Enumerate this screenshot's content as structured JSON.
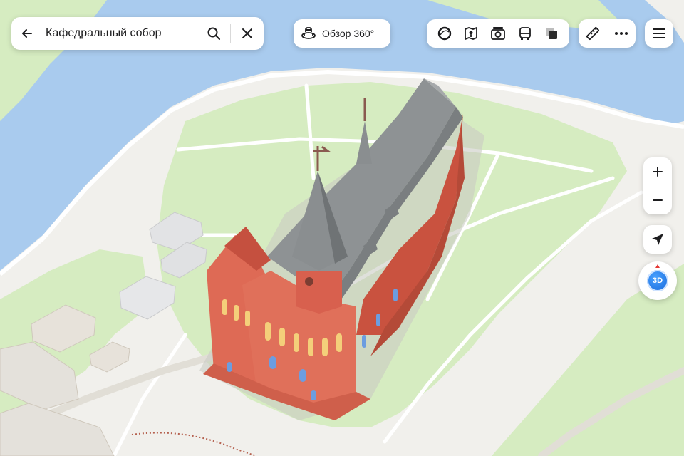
{
  "search": {
    "query": "Кафедральный собор"
  },
  "toolbar": {
    "panorama_label": "Обзор 360°"
  },
  "layers": [
    {
      "icon": "traffic-circle-icon"
    },
    {
      "icon": "map-book-icon"
    },
    {
      "icon": "photo-camera-icon"
    },
    {
      "icon": "bus-icon"
    },
    {
      "icon": "layers-icon"
    }
  ],
  "tools": [
    {
      "icon": "ruler-icon"
    },
    {
      "icon": "more-dots-icon"
    }
  ],
  "controls": {
    "zoom_in": "+",
    "zoom_out": "−",
    "view_mode": "3D"
  },
  "colors": {
    "water": "#a9cbee",
    "park": "#d6ecc1",
    "ground": "#f1f0ec",
    "brick": "#d8604e",
    "roof": "#8e9294",
    "accent": "#1466d8"
  }
}
